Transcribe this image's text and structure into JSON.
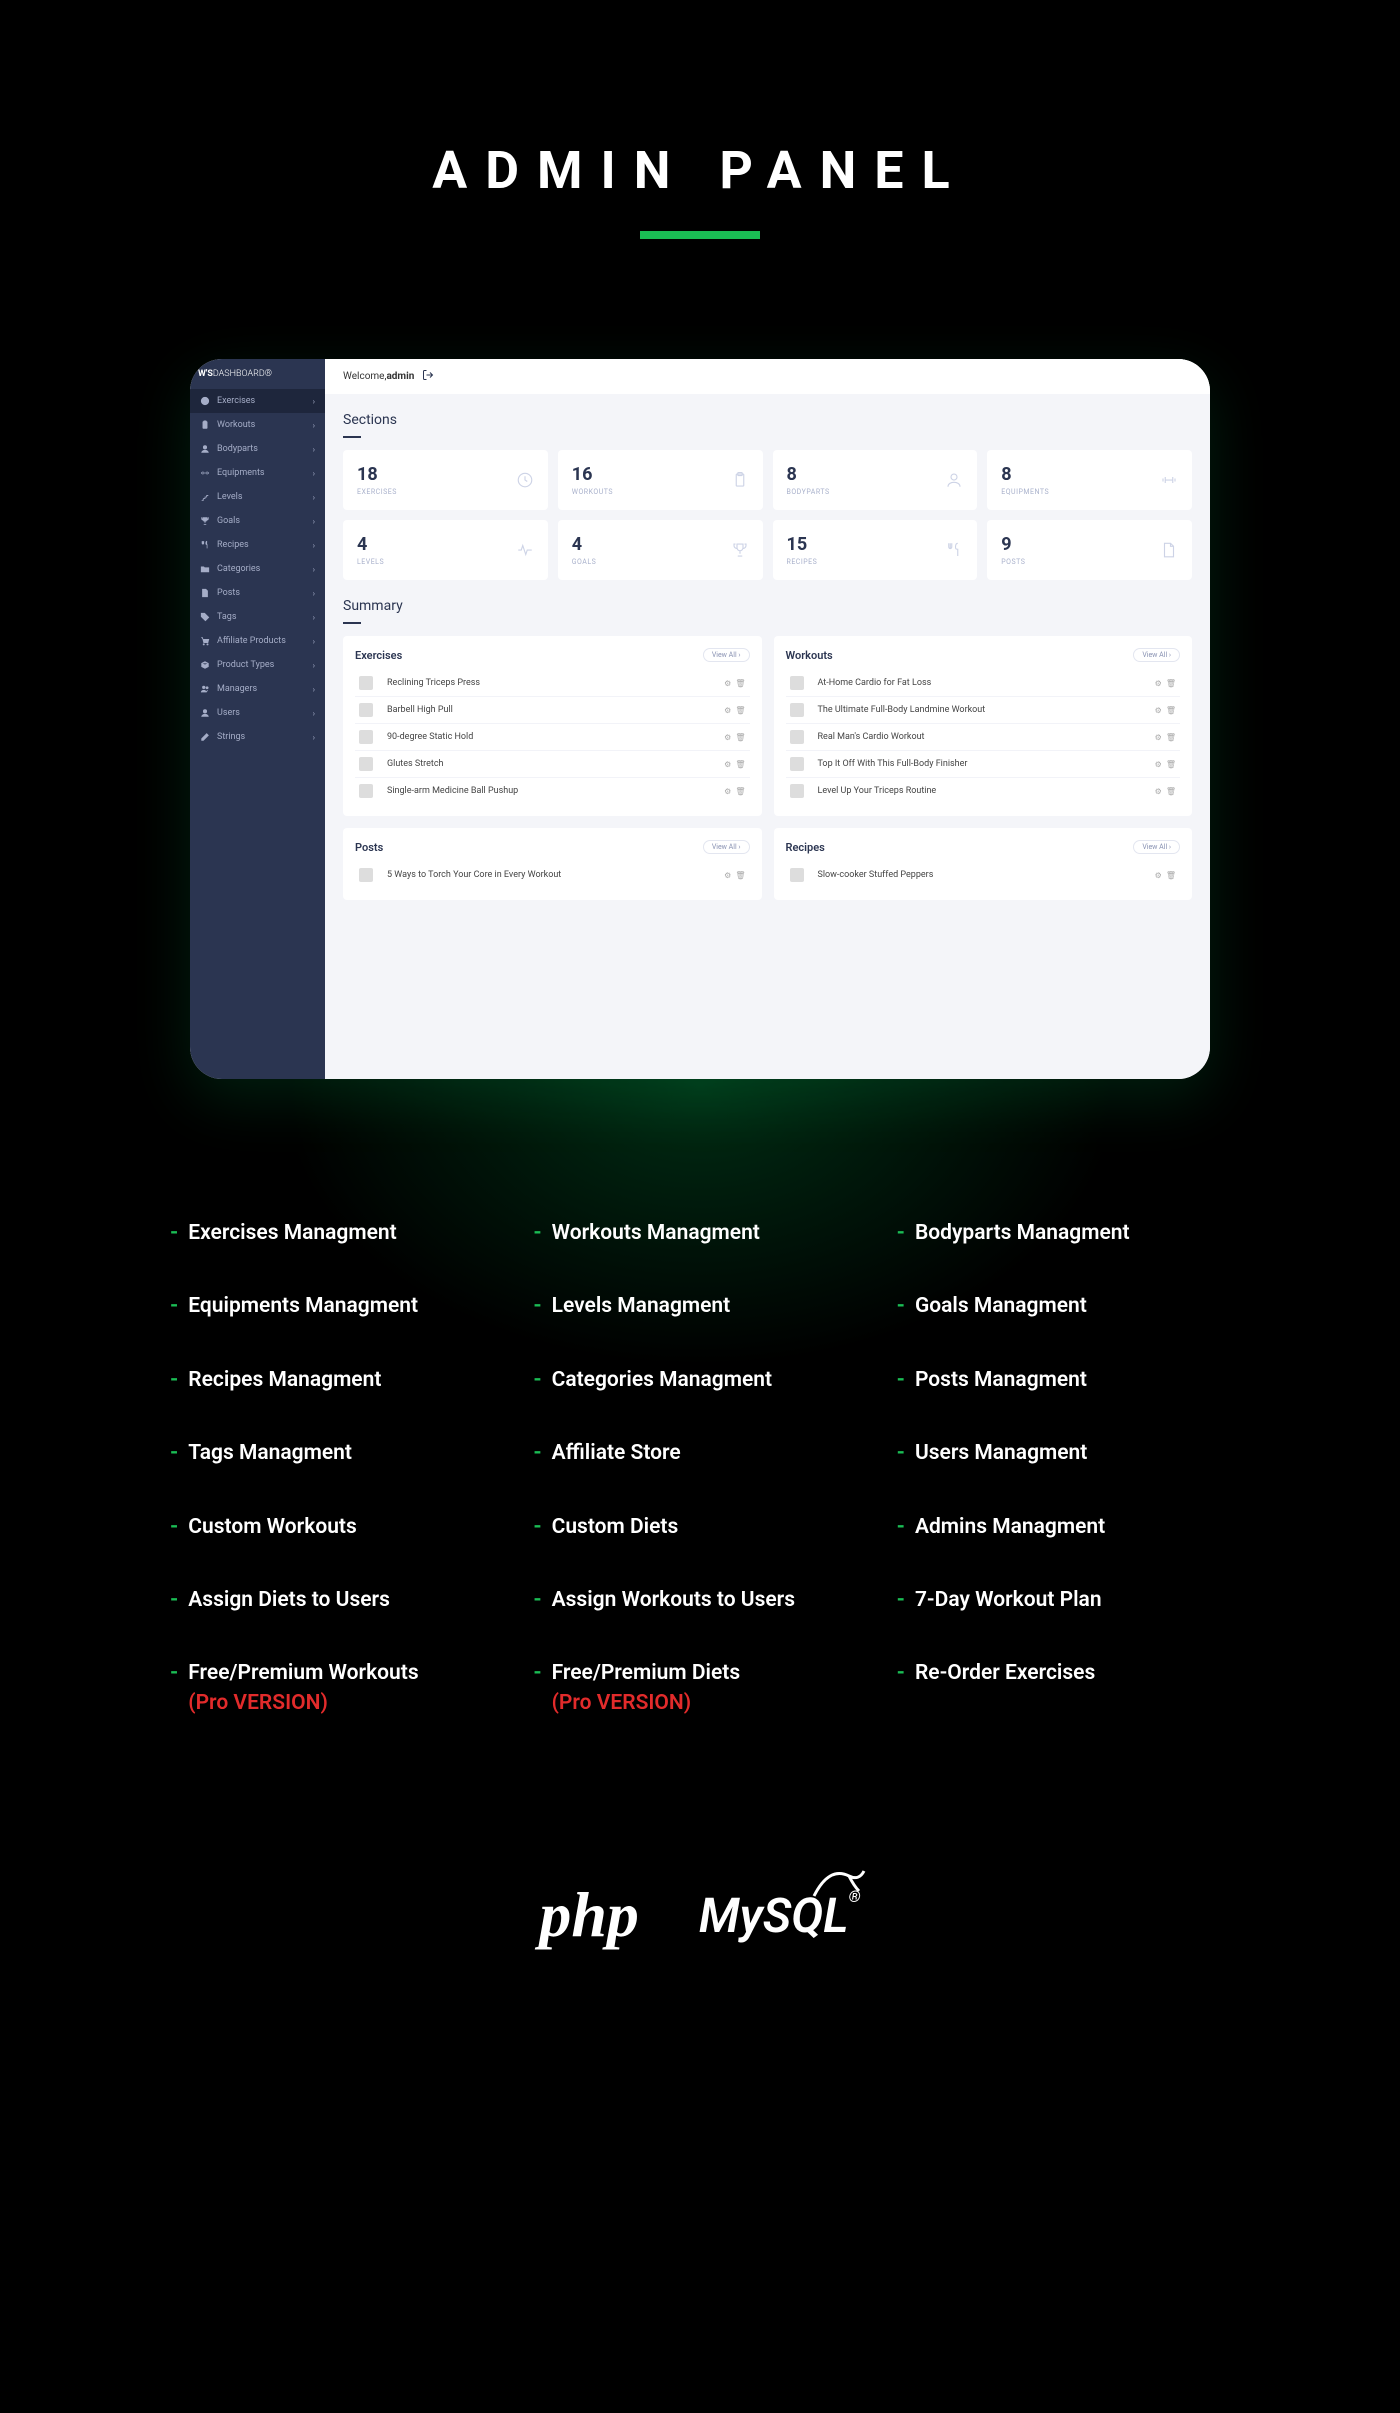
{
  "hero": {
    "title": "ADMIN PANEL"
  },
  "dashboard": {
    "logo_bold": "W'S",
    "logo_light": "DASHBOARD®",
    "welcome_prefix": "Welcome, ",
    "welcome_user": "admin",
    "sidebar": [
      {
        "label": "Exercises",
        "icon": "clock"
      },
      {
        "label": "Workouts",
        "icon": "clipboard"
      },
      {
        "label": "Bodyparts",
        "icon": "person"
      },
      {
        "label": "Equipments",
        "icon": "dumbbell"
      },
      {
        "label": "Levels",
        "icon": "stairs"
      },
      {
        "label": "Goals",
        "icon": "trophy"
      },
      {
        "label": "Recipes",
        "icon": "utensils"
      },
      {
        "label": "Categories",
        "icon": "folder"
      },
      {
        "label": "Posts",
        "icon": "file"
      },
      {
        "label": "Tags",
        "icon": "tag"
      },
      {
        "label": "Affiliate Products",
        "icon": "cart"
      },
      {
        "label": "Product Types",
        "icon": "box"
      },
      {
        "label": "Managers",
        "icon": "users"
      },
      {
        "label": "Users",
        "icon": "user"
      },
      {
        "label": "Strings",
        "icon": "edit"
      }
    ],
    "sections_title": "Sections",
    "stats": [
      {
        "num": "18",
        "label": "EXERCISES",
        "icon": "clock"
      },
      {
        "num": "16",
        "label": "WORKOUTS",
        "icon": "clipboard"
      },
      {
        "num": "8",
        "label": "BODYPARTS",
        "icon": "person"
      },
      {
        "num": "8",
        "label": "EQUIPMENTS",
        "icon": "dumbbell"
      },
      {
        "num": "4",
        "label": "LEVELS",
        "icon": "pulse"
      },
      {
        "num": "4",
        "label": "GOALS",
        "icon": "trophy"
      },
      {
        "num": "15",
        "label": "RECIPES",
        "icon": "utensils"
      },
      {
        "num": "9",
        "label": "POSTS",
        "icon": "file"
      }
    ],
    "summary_title": "Summary",
    "view_all": "View All  ›",
    "panels": {
      "exercises": {
        "title": "Exercises",
        "rows": [
          "Reclining Triceps Press",
          "Barbell High Pull",
          "90-degree Static Hold",
          "Glutes Stretch",
          "Single-arm Medicine Ball Pushup"
        ]
      },
      "workouts": {
        "title": "Workouts",
        "rows": [
          "At-Home Cardio for Fat Loss",
          "The Ultimate Full-Body Landmine Workout",
          "Real Man's Cardio Workout",
          "Top It Off With This Full-Body Finisher",
          "Level Up Your Triceps Routine"
        ]
      },
      "posts": {
        "title": "Posts",
        "rows": [
          "5 Ways to Torch Your Core in Every Workout"
        ]
      },
      "recipes": {
        "title": "Recipes",
        "rows": [
          "Slow-cooker Stuffed Peppers"
        ]
      }
    }
  },
  "features": [
    {
      "text": "Exercises Managment"
    },
    {
      "text": "Workouts Managment"
    },
    {
      "text": "Bodyparts Managment"
    },
    {
      "text": "Equipments Managment"
    },
    {
      "text": "Levels Managment"
    },
    {
      "text": "Goals Managment"
    },
    {
      "text": "Recipes Managment"
    },
    {
      "text": "Categories Managment"
    },
    {
      "text": "Posts Managment"
    },
    {
      "text": "Tags Managment"
    },
    {
      "text": "Affiliate Store"
    },
    {
      "text": "Users Managment"
    },
    {
      "text": "Custom Workouts"
    },
    {
      "text": "Custom Diets"
    },
    {
      "text": "Admins Managment"
    },
    {
      "text": "Assign Diets to Users"
    },
    {
      "text": "Assign Workouts to Users"
    },
    {
      "text": "7-Day Workout Plan"
    },
    {
      "text": "Free/Premium Workouts",
      "pro": "(Pro VERSION)"
    },
    {
      "text": "Free/Premium Diets",
      "pro": "(Pro VERSION)"
    },
    {
      "text": "Re-Order Exercises"
    }
  ],
  "tech": {
    "php": "php",
    "mysql": "MySQL"
  }
}
